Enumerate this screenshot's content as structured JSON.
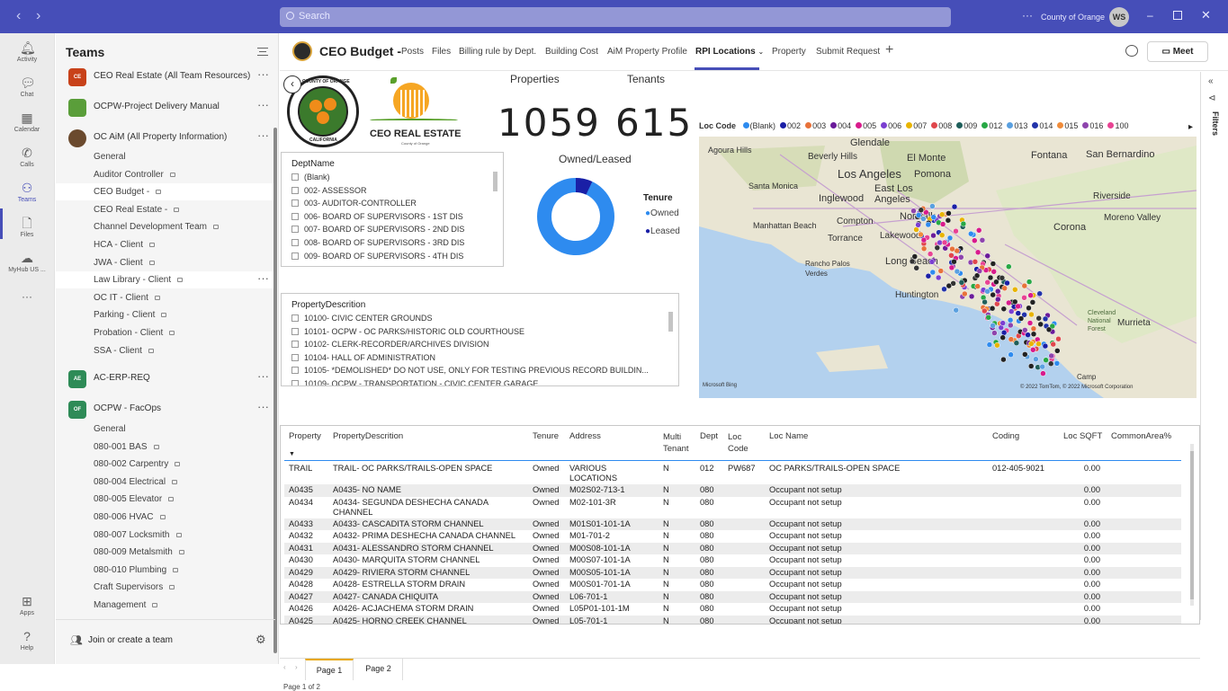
{
  "titlebar": {
    "search_placeholder": "Search",
    "org": "County of Orange",
    "avatar": "WS"
  },
  "rail": [
    {
      "label": "Activity",
      "icon": "bell-icon"
    },
    {
      "label": "Chat",
      "icon": "chat-icon"
    },
    {
      "label": "Calendar",
      "icon": "calendar-icon"
    },
    {
      "label": "Calls",
      "icon": "phone-icon"
    },
    {
      "label": "Teams",
      "icon": "teams-icon"
    },
    {
      "label": "Files",
      "icon": "file-icon"
    },
    {
      "label": "MyHub US ...",
      "icon": "cloud-icon"
    },
    {
      "label": "Apps",
      "icon": "apps-icon"
    },
    {
      "label": "Help",
      "icon": "help-icon"
    }
  ],
  "teams_panel": {
    "title": "Teams",
    "join_label": "Join or create a team",
    "teams": [
      {
        "abbr": "CE",
        "name": "CEO Real Estate (All Team Resources)",
        "color": "#c8421a"
      },
      {
        "abbr": "",
        "name": "OCPW-Project Delivery Manual",
        "color": "#5a9e3a"
      },
      {
        "abbr": "",
        "name": "OC AiM (All Property Information)",
        "color": "#6b4a2e"
      },
      {
        "abbr": "AE",
        "name": "AC-ERP-REQ",
        "color": "#2e8b57"
      },
      {
        "abbr": "OF",
        "name": "OCPW - FacOps",
        "color": "#2e8b57"
      }
    ],
    "channels_aim": [
      "General",
      "Auditor Controller",
      "CEO Budget -",
      "CEO Real Estate -",
      "Channel Development Team",
      "HCA - Client",
      "JWA - Client",
      "Law Library - Client",
      "OC IT - Client",
      "Parking - Client",
      "Probation - Client",
      "SSA - Client"
    ],
    "channels_facops": [
      "General",
      "080-001 BAS",
      "080-002 Carpentry",
      "080-004 Electrical",
      "080-005 Elevator",
      "080-006 HVAC",
      "080-007 Locksmith",
      "080-009 Metalsmith",
      "080-010 Plumbing",
      "Craft Supervisors",
      "Management"
    ]
  },
  "header": {
    "channel_title": "CEO Budget -",
    "tabs": [
      "Posts",
      "Files",
      "Billing rule by Dept.",
      "Building Cost",
      "AiM Property Profile",
      "RPI Locations",
      "Property",
      "Submit Request"
    ],
    "active_tab": "RPI Locations",
    "meet_label": "Meet"
  },
  "report": {
    "seal_text": [
      "COUNTY OF ORANGE",
      "CALIFORNIA"
    ],
    "ceo_logo_text": "CEO REAL ESTATE",
    "ceo_logo_sub": "County of Orange",
    "properties_label": "Properties",
    "properties_value": "1059",
    "tenants_label": "Tenants",
    "tenants_value": "615",
    "donut_title": "Owned/Leased",
    "donut": {
      "owned": 0.93,
      "leased": 0.07,
      "owned_color": "#2e8bef",
      "leased_color": "#1a1fa6"
    },
    "tenure_legend": {
      "title": "Tenure",
      "owned": "Owned",
      "leased": "Leased"
    },
    "dept_slicer": {
      "title": "DeptName",
      "items": [
        "(Blank)",
        "002- ASSESSOR",
        "003- AUDITOR-CONTROLLER",
        "006- BOARD OF SUPERVISORS - 1ST DIS",
        "007- BOARD OF SUPERVISORS - 2ND DIS",
        "008- BOARD OF SUPERVISORS - 3RD DIS",
        "009- BOARD OF SUPERVISORS - 4TH DIS"
      ]
    },
    "prop_slicer": {
      "title": "PropertyDescrition",
      "items": [
        "10100- CIVIC CENTER GROUNDS",
        "10101- OCPW - OC PARKS/HISTORIC OLD COURTHOUSE",
        "10102- CLERK-RECORDER/ARCHIVES DIVISION",
        "10104- HALL OF ADMINISTRATION",
        "10105- *DEMOLISHED* DO NOT USE, ONLY FOR TESTING PREVIOUS RECORD BUILDIN...",
        "10109- OCPW - TRANSPORTATION - CIVIC CENTER GARAGE"
      ]
    },
    "map_legend": {
      "title": "Loc Code",
      "items": [
        {
          "label": "(Blank)",
          "color": "#2e8bef"
        },
        {
          "label": "002",
          "color": "#1a1fa6"
        },
        {
          "label": "003",
          "color": "#e8723a"
        },
        {
          "label": "004",
          "color": "#6a1b9a"
        },
        {
          "label": "005",
          "color": "#d81b8c"
        },
        {
          "label": "006",
          "color": "#7b3fd1"
        },
        {
          "label": "007",
          "color": "#e8b400"
        },
        {
          "label": "008",
          "color": "#e0474c"
        },
        {
          "label": "009",
          "color": "#1f5f5b"
        },
        {
          "label": "012",
          "color": "#27a845"
        },
        {
          "label": "013",
          "color": "#5aa0e0"
        },
        {
          "label": "014",
          "color": "#2233aa"
        },
        {
          "label": "015",
          "color": "#f08c3a"
        },
        {
          "label": "016",
          "color": "#8e44ad"
        },
        {
          "label": "100",
          "color": "#e84393"
        }
      ]
    },
    "map_labels": [
      "Agoura Hills",
      "Beverly Hills",
      "Glendale",
      "El Monte",
      "Fontana",
      "San Bernardino",
      "Los Angeles",
      "Pomona",
      "Santa Monica",
      "Inglewood",
      "East Los Angeles",
      "Riverside",
      "Manhattan Beach",
      "Compton",
      "Norwalk",
      "Corona",
      "Moreno Valley",
      "Torrance",
      "Lakewood",
      "Rancho Palos Verdes",
      "Long Beach",
      "Huntington",
      "Cleveland National Forest",
      "Murrieta",
      "Camp"
    ],
    "map_attribution": "© 2022 TomTom, © 2022 Microsoft Corporation",
    "map_brand": "Microsoft Bing",
    "table": {
      "headers": [
        "Property",
        "PropertyDescrition",
        "Tenure",
        "Address",
        "Multi Tenant",
        "Dept",
        "Loc Code",
        "Loc Name",
        "Coding",
        "Loc SQFT",
        "CommonArea%"
      ],
      "rows": [
        [
          "TRAIL",
          "TRAIL- OC PARKS/TRAILS-OPEN SPACE",
          "Owned",
          "VARIOUS LOCATIONS",
          "N",
          "012",
          "PW687",
          "OC PARKS/TRAILS-OPEN SPACE",
          "012-405-9021",
          "0.00"
        ],
        [
          "A0435",
          "A0435- NO NAME",
          "Owned",
          "M02S02-713-1",
          "N",
          "080",
          "",
          "Occupant not setup",
          "",
          "0.00"
        ],
        [
          "A0434",
          "A0434- SEGUNDA DESHECHA CANADA CHANNEL",
          "Owned",
          "M02-101-3R",
          "N",
          "080",
          "",
          "Occupant not setup",
          "",
          "0.00"
        ],
        [
          "A0433",
          "A0433- CASCADITA STORM CHANNEL",
          "Owned",
          "M01S01-101-1A",
          "N",
          "080",
          "",
          "Occupant not setup",
          "",
          "0.00"
        ],
        [
          "A0432",
          "A0432- PRIMA DESHECHA CANADA CHANNEL",
          "Owned",
          "M01-701-2",
          "N",
          "080",
          "",
          "Occupant not setup",
          "",
          "0.00"
        ],
        [
          "A0431",
          "A0431- ALESSANDRO STORM CHANNEL",
          "Owned",
          "M00S08-101-1A",
          "N",
          "080",
          "",
          "Occupant not setup",
          "",
          "0.00"
        ],
        [
          "A0430",
          "A0430- MARQUITA STORM CHANNEL",
          "Owned",
          "M00S07-101-1A",
          "N",
          "080",
          "",
          "Occupant not setup",
          "",
          "0.00"
        ],
        [
          "A0429",
          "A0429- RIVIERA STORM CHANNEL",
          "Owned",
          "M00S05-101-1A",
          "N",
          "080",
          "",
          "Occupant not setup",
          "",
          "0.00"
        ],
        [
          "A0428",
          "A0428- ESTRELLA STORM DRAIN",
          "Owned",
          "M00S01-701-1A",
          "N",
          "080",
          "",
          "Occupant not setup",
          "",
          "0.00"
        ],
        [
          "A0427",
          "A0427- CANADA CHIQUITA",
          "Owned",
          "L06-701-1",
          "N",
          "080",
          "",
          "Occupant not setup",
          "",
          "0.00"
        ],
        [
          "A0426",
          "A0426- ACJACHEMA STORM DRAIN",
          "Owned",
          "L05P01-101-1M",
          "N",
          "080",
          "",
          "Occupant not setup",
          "",
          "0.00"
        ],
        [
          "A0425",
          "A0425- HORNO CREEK CHANNEL",
          "Owned",
          "L05-701-1",
          "N",
          "080",
          "",
          "Occupant not setup",
          "",
          "0.00"
        ]
      ]
    },
    "pages": [
      "Page 1",
      "Page 2"
    ],
    "page_footer": "Page 1 of 2",
    "filters_label": "Filters"
  }
}
